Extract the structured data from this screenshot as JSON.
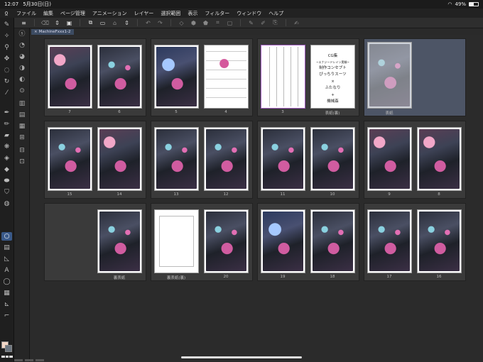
{
  "status": {
    "time": "12:07",
    "date": "5月30日(日)",
    "battery": "49%",
    "battery_level": 0.49
  },
  "menu": [
    "ファイル",
    "編集",
    "ページ管理",
    "アニメーション",
    "レイヤー",
    "選択範囲",
    "表示",
    "フィルター",
    "ウィンドウ",
    "ヘルプ"
  ],
  "tab": {
    "label": "MachineFxxx1-2"
  },
  "pages": {
    "p7": "7",
    "p6": "6",
    "p5": "5",
    "p4": "4",
    "p3": "3",
    "p_cover_back": "表紙(裏)",
    "p_cover": "表紙",
    "p15": "15",
    "p14": "14",
    "p13": "13",
    "p12": "12",
    "p11": "11",
    "p10": "10",
    "p9": "9",
    "p8": "8",
    "p_back_inner": "裏表紙",
    "p_back_inner_rev": "裏表紙(裏)",
    "p20": "20",
    "p19": "19",
    "p18": "18",
    "p17": "17",
    "p16": "16"
  },
  "cover_text": {
    "line1": "CG集",
    "line2": "~エナジードレイン実験~",
    "line3": "制作コンセプト",
    "line4": "ぴっちりスーツ",
    "line5": "×",
    "line6": "ふたなり",
    "line7": "+",
    "line8": "機械姦"
  },
  "colors": {
    "selected_spread": "#4d5566",
    "accent": "#3a5a8a",
    "foreground_swatch": "#f3d7c6",
    "background_swatch": "#6c7680"
  }
}
